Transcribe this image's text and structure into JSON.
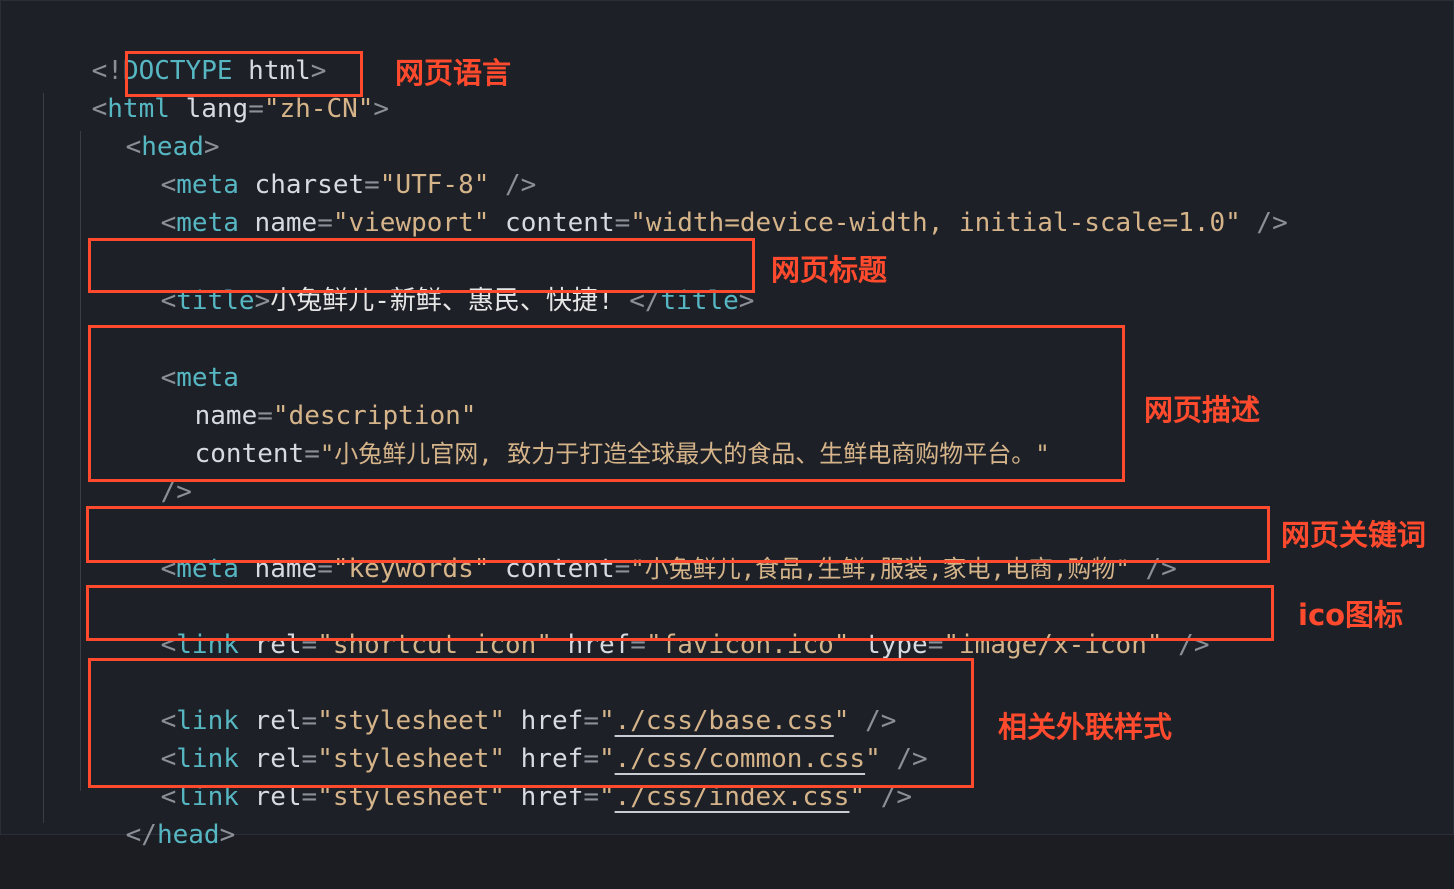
{
  "colors": {
    "background": "#1e2027",
    "tag": "#56b6c2",
    "attribute": "#d7dae0",
    "string": "#d6b48a",
    "punctuation": "#8b8f98",
    "annotation": "#ff4a2e"
  },
  "code": {
    "doctype": {
      "open": "<!",
      "keyword": "DOCTYPE",
      "name": " html",
      "close": ">"
    },
    "html_open": {
      "lt": "<",
      "tag": "html",
      "space": " ",
      "attr": "lang",
      "eq": "=",
      "val": "\"zh-CN\"",
      "gt": ">"
    },
    "head_open": {
      "lt": "<",
      "tag": "head",
      "gt": ">"
    },
    "meta_charset": {
      "lt": "<",
      "tag": "meta",
      "attr": " charset",
      "eq": "=",
      "val": "\"UTF-8\"",
      "close": " />"
    },
    "meta_viewport": {
      "lt": "<",
      "tag": "meta",
      "attr1": " name",
      "eq1": "=",
      "val1": "\"viewport\"",
      "attr2": " content",
      "eq2": "=",
      "val2": "\"width=device-width, initial-scale=1.0\"",
      "close": " />"
    },
    "title": {
      "lt": "<",
      "tag": "title",
      "gt": ">",
      "text": "小兔鲜儿-新鲜、惠民、快捷! ",
      "lt2": "</",
      "tag2": "title",
      "gt2": ">"
    },
    "meta_desc": {
      "line1_lt": "<",
      "line1_tag": "meta",
      "line2_attr": "name",
      "line2_eq": "=",
      "line2_val": "\"description\"",
      "line3_attr": "content",
      "line3_eq": "=",
      "line3_val": "\"小兔鲜儿官网, 致力于打造全球最大的食品、生鲜电商购物平台。\"",
      "line4_close": "/>"
    },
    "meta_keywords": {
      "lt": "<",
      "tag": "meta",
      "attr1": " name",
      "eq1": "=",
      "val1": "\"keywords\"",
      "attr2": " content",
      "eq2": "=",
      "val2": "\"小兔鲜儿,食品,生鲜,服装,家电,电商,购物\"",
      "close": " />"
    },
    "link_icon": {
      "lt": "<",
      "tag": "link",
      "attr1": " rel",
      "eq1": "=",
      "val1": "\"shortcut icon\"",
      "attr2": " href",
      "eq2": "=",
      "q1": "\"",
      "href": "favicon.ico",
      "q2": "\"",
      "attr3": " type",
      "eq3": "=",
      "val3": "\"image/x-icon\"",
      "close": " />"
    },
    "link_base": {
      "lt": "<",
      "tag": "link",
      "attr1": " rel",
      "eq1": "=",
      "val1": "\"stylesheet\"",
      "attr2": " href",
      "eq2": "=",
      "q1": "\"",
      "href": "./css/base.css",
      "q2": "\"",
      "close": " />"
    },
    "link_common": {
      "lt": "<",
      "tag": "link",
      "attr1": " rel",
      "eq1": "=",
      "val1": "\"stylesheet\"",
      "attr2": " href",
      "eq2": "=",
      "q1": "\"",
      "href": "./css/common.css",
      "q2": "\"",
      "close": " />"
    },
    "link_index": {
      "lt": "<",
      "tag": "link",
      "attr1": " rel",
      "eq1": "=",
      "val1": "\"stylesheet\"",
      "attr2": " href",
      "eq2": "=",
      "q1": "\"",
      "href": "./css/index.css",
      "q2": "\"",
      "close": " />"
    },
    "head_close": {
      "lt": "</",
      "tag": "head",
      "gt": ">"
    }
  },
  "annotations": {
    "lang": "网页语言",
    "title": "网页标题",
    "description": "网页描述",
    "keywords": "网页关键词",
    "icon": "ico图标",
    "stylesheets": "相关外联样式"
  }
}
